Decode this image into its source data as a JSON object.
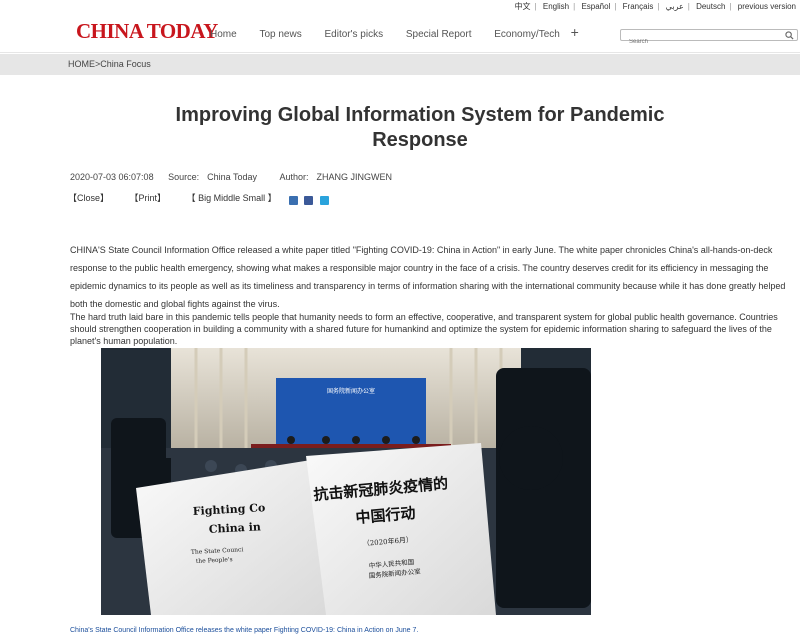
{
  "lang_bar": [
    "中文",
    "English",
    "Español",
    "Français",
    "عربي",
    "Deutsch",
    "previous version"
  ],
  "header": {
    "logo": "CHINA TODAY",
    "nav": [
      "Home",
      "Top news",
      "Editor's picks",
      "Special Report",
      "Economy/Tech"
    ],
    "more_icon": "+",
    "search_placeholder": "Search"
  },
  "breadcrumb": "HOME>China Focus",
  "article": {
    "title": "Improving Global Information System for Pandemic Response",
    "date": "2020-07-03 06:07:08",
    "source_label": "Source:",
    "source": "China Today",
    "author_label": "Author:",
    "author": "ZHANG JINGWEN",
    "tools": [
      "【Close】",
      "【Print】",
      "【 Big Middle Small 】"
    ],
    "share_icons": [
      "email-icon",
      "facebook-icon",
      "twitter-icon"
    ],
    "paragraph1": "CHINA'S State Council Information Office released a white paper titled \"Fighting COVID-19: China in Action\" in early June. The white paper chronicles China's all-hands-on-deck response to the public health emergency, showing what makes a responsible major country in the face of a crisis. The country deserves credit for its efficiency in messaging the epidemic dynamics to its people as well as its timeliness and transparency in terms of information sharing with the international community because while it has done greatly helped both the domestic and global fights against the virus.",
    "paragraph2": "The hard truth laid bare in this pandemic tells people that humanity needs to form an effective, cooperative, and transparent system for global public health governance. Countries should strengthen cooperation in building a community with a shared future for humankind and optimize the system for epidemic information sharing to safeguard the lives of the planet's human population.",
    "photo": {
      "banner_text": "国务院新闻办公室",
      "book_en_line1": "Fighting Co",
      "book_en_line2": "China in",
      "book_en_small1": "The State Counci",
      "book_en_small2": "the People's",
      "book_cn_line1": "抗击新冠肺炎疫情的",
      "book_cn_line2": "中国行动",
      "book_cn_date": "（2020年6月）",
      "book_cn_pub1": "中华人民共和国",
      "book_cn_pub2": "国务院新闻办公室"
    },
    "caption": "China's State Council Information Office releases the white paper Fighting COVID-19: China in Action on June 7."
  },
  "colors": {
    "logo": "#c8161d",
    "breadcrumb_bg": "#e6e6e6",
    "caption": "#1b4e9b",
    "banner_blue": "#1e56b0"
  }
}
